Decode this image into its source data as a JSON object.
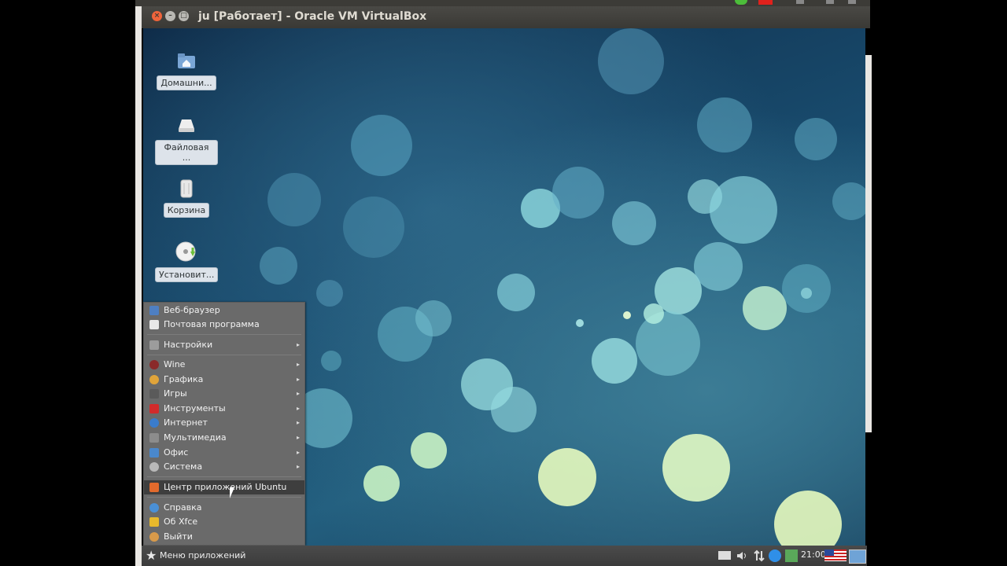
{
  "window": {
    "title": "ju [Работает] - Oracle VM VirtualBox"
  },
  "desktop_icons": [
    {
      "label": "Домашни...",
      "icon": "home-folder-icon"
    },
    {
      "label": "Файловая ...",
      "icon": "drive-icon"
    },
    {
      "label": "Корзина",
      "icon": "trash-icon"
    },
    {
      "label": "Установит...",
      "icon": "install-disc-icon"
    }
  ],
  "menu": {
    "items": [
      {
        "label": "Веб-браузер",
        "icon": "web-browser-icon",
        "submenu": false
      },
      {
        "label": "Почтовая программа",
        "icon": "mail-icon",
        "submenu": false
      },
      {
        "label": "Настройки",
        "icon": "settings-icon",
        "submenu": true
      },
      {
        "label": "Wine",
        "icon": "wine-icon",
        "submenu": true
      },
      {
        "label": "Графика",
        "icon": "graphics-icon",
        "submenu": true
      },
      {
        "label": "Игры",
        "icon": "games-icon",
        "submenu": true
      },
      {
        "label": "Инструменты",
        "icon": "tools-icon",
        "submenu": true
      },
      {
        "label": "Интернет",
        "icon": "internet-icon",
        "submenu": true
      },
      {
        "label": "Мультимедиа",
        "icon": "multimedia-icon",
        "submenu": true
      },
      {
        "label": "Офис",
        "icon": "office-icon",
        "submenu": true
      },
      {
        "label": "Система",
        "icon": "system-icon",
        "submenu": true
      },
      {
        "label": "Центр приложений Ubuntu",
        "icon": "software-center-icon",
        "submenu": false,
        "highlighted": true
      },
      {
        "label": "Справка",
        "icon": "help-icon",
        "submenu": false
      },
      {
        "label": "Об Xfce",
        "icon": "about-xfce-icon",
        "submenu": false
      },
      {
        "label": "Выйти",
        "icon": "logout-icon",
        "submenu": false
      }
    ]
  },
  "panel": {
    "start_label": "Меню приложений",
    "clock": "21:00",
    "tray_icons": [
      "mail-icon",
      "volume-icon",
      "network-icon",
      "update-notice-icon",
      "battery-icon",
      "us-flag-icon",
      "desktop-icon"
    ]
  },
  "colors": {
    "menu_bg": "#6a6a6a",
    "menu_highlight": "#3e3e3e",
    "titlebar": "#3c3b37",
    "close_button": "#f0643b"
  }
}
